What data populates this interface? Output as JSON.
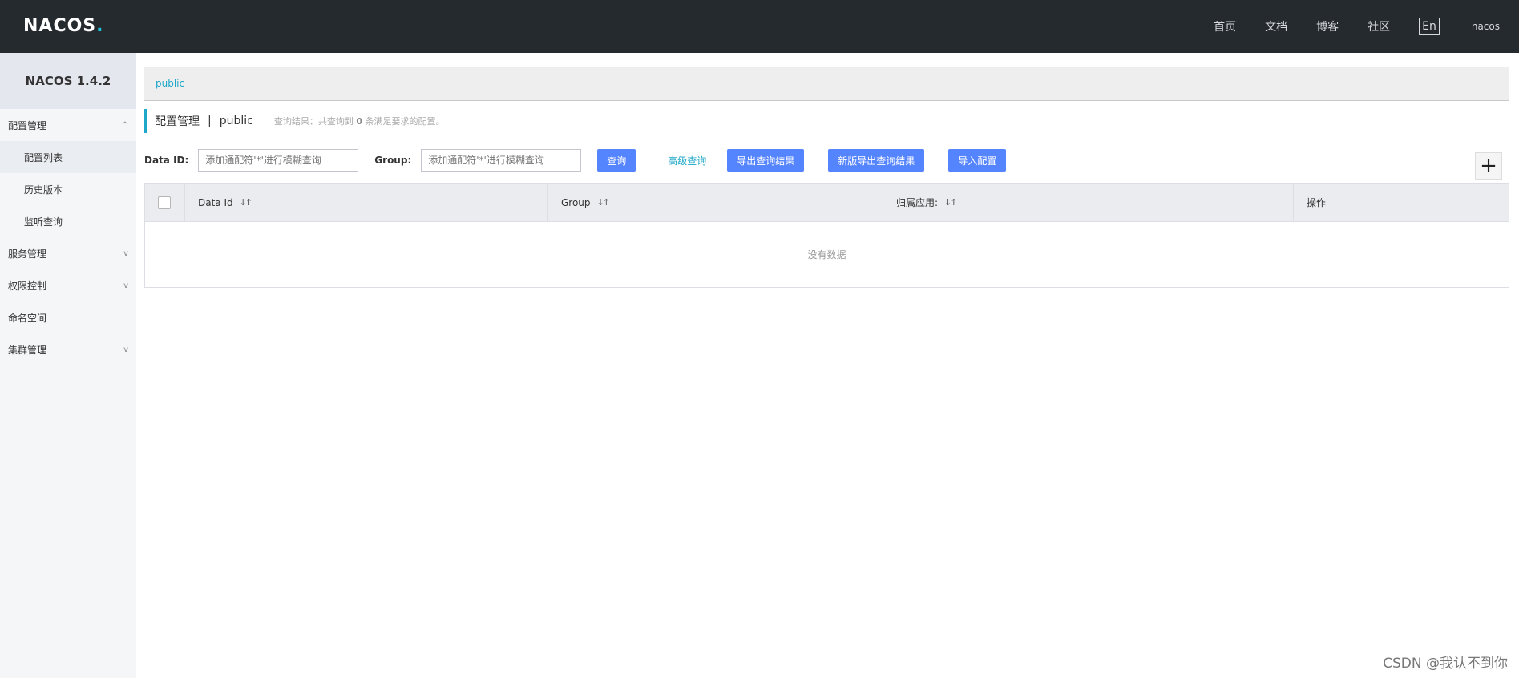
{
  "header": {
    "logo_text": "NACOS",
    "logo_dot": ".",
    "nav": [
      "首页",
      "文档",
      "博客",
      "社区"
    ],
    "lang": "En",
    "user": "nacos"
  },
  "sidebar": {
    "version": "NACOS 1.4.2",
    "groups": [
      {
        "label": "配置管理",
        "icon": "chevron-up-icon",
        "glyph": "^"
      },
      {
        "label": "服务管理",
        "icon": "chevron-down-icon",
        "glyph": "v"
      },
      {
        "label": "权限控制",
        "icon": "chevron-down-icon",
        "glyph": "v"
      },
      {
        "label": "命名空间"
      },
      {
        "label": "集群管理",
        "icon": "chevron-down-icon",
        "glyph": "v"
      }
    ],
    "config_items": [
      "配置列表",
      "历史版本",
      "监听查询"
    ]
  },
  "namespace_bar": {
    "selected": "public"
  },
  "title": {
    "main": "配置管理",
    "sep": "|",
    "namespace": "public",
    "info_prefix": "查询结果：共查询到",
    "info_count": "0",
    "info_suffix": "条满足要求的配置。"
  },
  "filters": {
    "dataid_label": "Data ID:",
    "dataid_placeholder": "添加通配符'*'进行模糊查询",
    "group_label": "Group:",
    "group_placeholder": "添加通配符'*'进行模糊查询",
    "query_btn": "查询",
    "advanced_link": "高级查询",
    "export_btn": "导出查询结果",
    "export_new_btn": "新版导出查询结果",
    "import_btn": "导入配置",
    "add_glyph": "+"
  },
  "table": {
    "columns": [
      "Data Id",
      "Group",
      "归属应用:",
      "操作"
    ],
    "sort_glyph": "↓↑",
    "empty": "没有数据"
  },
  "watermark": "CSDN @我认不到你",
  "colors": {
    "header_bg": "#252a2f",
    "accent": "#1ea7c8",
    "primary_btn": "#5584ff"
  }
}
